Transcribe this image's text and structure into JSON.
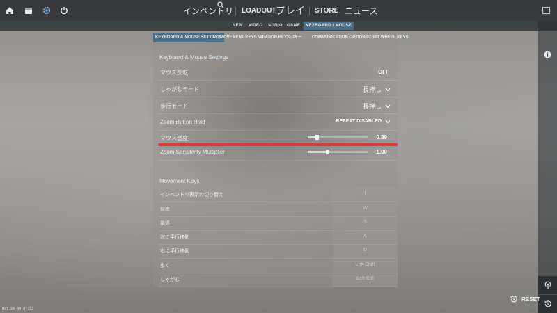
{
  "topbar": {
    "nav": [
      "インベントリ",
      "LOADOUT",
      "プレイ",
      "STORE",
      "ニュース"
    ]
  },
  "subtabs": [
    "NEW",
    "VIDEO",
    "AUDIO",
    "GAME",
    "KEYBOARD / MOUSE"
  ],
  "tertiary_tabs": [
    "KEYBOARD & MOUSE SETTINGS",
    "MOVEMENT KEYS",
    "WEAPON KEYS",
    "UIキー",
    "COMMUNICATION OPTIONS",
    "CHAT WHEEL KEYS"
  ],
  "kms": {
    "title": "Keyboard & Mouse Settings",
    "rows": [
      {
        "label": "マウス反転",
        "value": "OFF"
      },
      {
        "label": "しゃがむモード",
        "value": "長押し"
      },
      {
        "label": "歩行モード",
        "value": "長押し"
      },
      {
        "label": "Zoom Button Hold",
        "value": "REPEAT DISABLED"
      }
    ],
    "sliders": [
      {
        "label": "マウス感度",
        "value": "0.89",
        "fraction": 0.15
      },
      {
        "label": "Zoom Sensitivity Multiplier",
        "value": "1.00",
        "fraction": 0.33
      }
    ]
  },
  "movement": {
    "title": "Movement Keys",
    "rows": [
      {
        "label": "インベントリ表示の切り替え",
        "key": "I"
      },
      {
        "label": "前進",
        "key": "W"
      },
      {
        "label": "後退",
        "key": "S"
      },
      {
        "label": "左に平行移動",
        "key": "A"
      },
      {
        "label": "右に平行移動",
        "key": "D"
      },
      {
        "label": "歩く",
        "key": "Left Shift"
      },
      {
        "label": "しゃがむ",
        "key": "Left Ctrl"
      }
    ]
  },
  "reset_label": "RESET",
  "footer_text": "Oct 24 04 07:13",
  "colors": {
    "accent": "#4a6f87",
    "highlight": "#e0363a"
  }
}
